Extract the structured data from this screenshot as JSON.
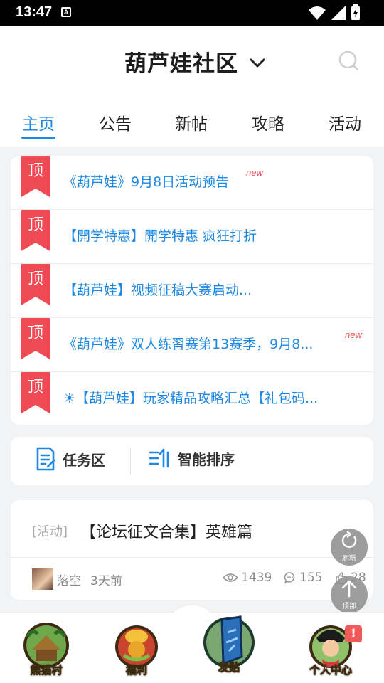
{
  "status": {
    "time": "13:47",
    "a_badge": "A"
  },
  "header": {
    "title": "葫芦娃社区"
  },
  "tabs": [
    {
      "label": "主页",
      "active": true
    },
    {
      "label": "公告",
      "active": false
    },
    {
      "label": "新帖",
      "active": false
    },
    {
      "label": "攻略",
      "active": false
    },
    {
      "label": "活动",
      "active": false
    }
  ],
  "pinned": {
    "badge": "顶",
    "items": [
      {
        "text": "《葫芦娃》9月8日活动预告",
        "new": "new"
      },
      {
        "text": "【開学特惠】開学特惠 疯狂打折",
        "new": ""
      },
      {
        "text": "【葫芦娃】视频征稿大赛启动...",
        "new": ""
      },
      {
        "text": "《葫芦娃》双人练習赛第13赛季，9月8...",
        "new": "new"
      },
      {
        "text": "☀【葫芦娃】玩家精品攻略汇总【礼包码...",
        "new": ""
      }
    ]
  },
  "toolbar": {
    "task_label": "任务区",
    "sort_label": "智能排序"
  },
  "post": {
    "tag": "[活动]",
    "title": "【论坛征文合集】英雄篇",
    "author": "落空",
    "time": "3天前",
    "views": "1439",
    "comments": "155",
    "likes": "28"
  },
  "float": {
    "refresh_label": "刷新",
    "top_label": "顶部"
  },
  "bottom_nav": [
    {
      "label": "熊猫村",
      "icon": "village-icon"
    },
    {
      "label": "福利",
      "icon": "gift-icon"
    },
    {
      "label": "发贴",
      "icon": "post-icon"
    },
    {
      "label": "个人中心",
      "icon": "profile-icon"
    }
  ],
  "alert_badge": "!",
  "colors": {
    "accent": "#1e88e5",
    "pin_red": "#f04a54",
    "new_red": "#f04a54"
  }
}
